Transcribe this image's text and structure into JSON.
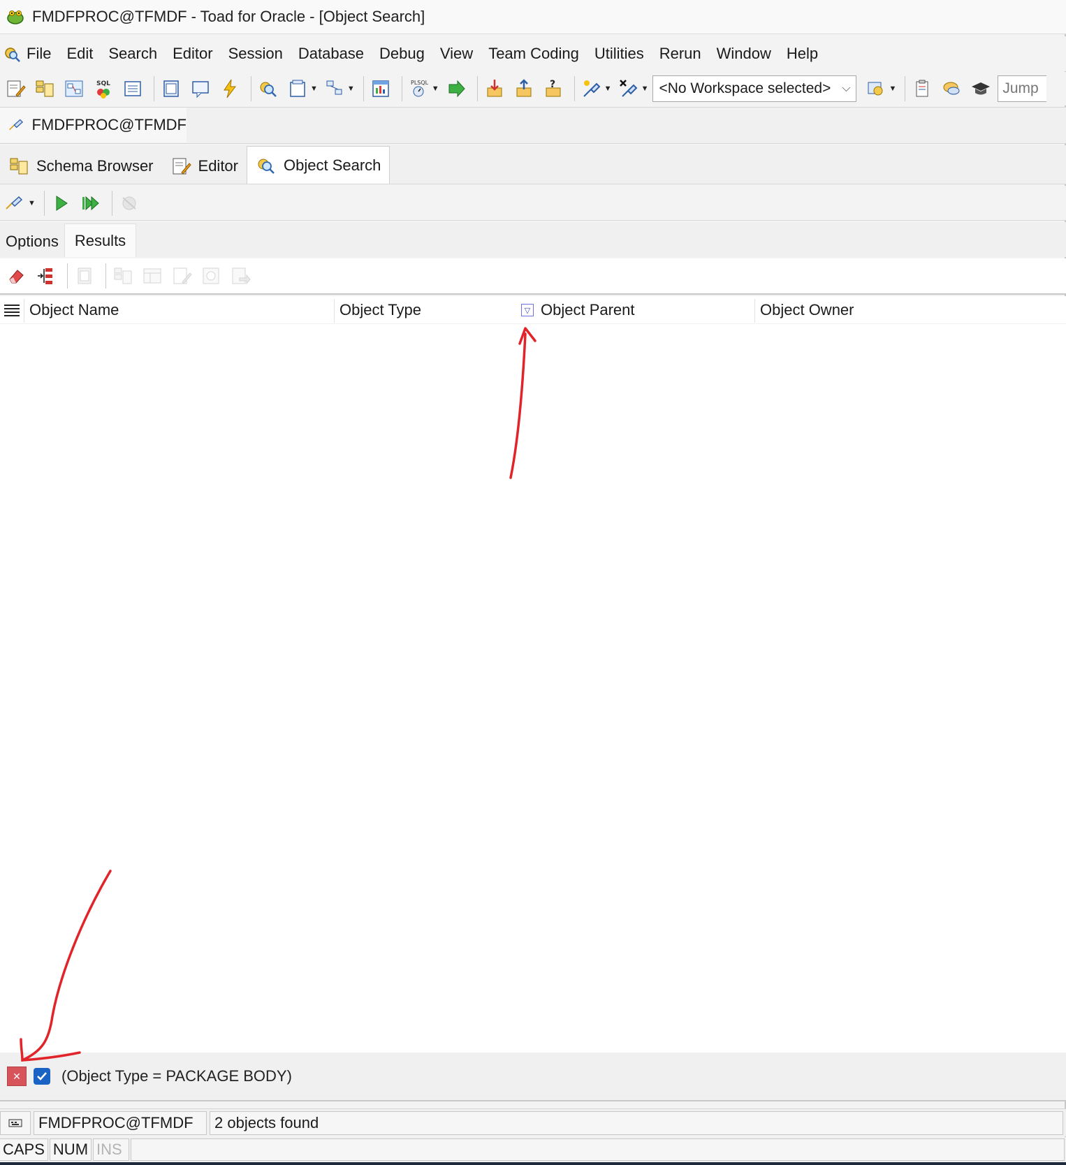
{
  "window": {
    "title": "FMDFPROC@TFMDF - Toad for Oracle - [Object Search]"
  },
  "menu": [
    "File",
    "Edit",
    "Search",
    "Editor",
    "Session",
    "Database",
    "Debug",
    "View",
    "Team Coding",
    "Utilities",
    "Rerun",
    "Window",
    "Help"
  ],
  "toolbar": {
    "workspace_value": "<No Workspace selected>",
    "jump_placeholder": "Jump"
  },
  "connection": {
    "label": "FMDFPROC@TFMDF"
  },
  "window_tabs": [
    {
      "label": "Schema Browser",
      "icon": "schema-browser-icon"
    },
    {
      "label": "Editor",
      "icon": "editor-icon"
    },
    {
      "label": "Object Search",
      "icon": "object-search-icon",
      "active": true
    }
  ],
  "sub_tabs": [
    {
      "label": "Options"
    },
    {
      "label": "Results",
      "active": true
    }
  ],
  "grid": {
    "columns": [
      "Object Name",
      "Object Type",
      "Object Parent",
      "Object Owner"
    ],
    "rows": []
  },
  "filter": {
    "expression": "(Object Type = PACKAGE BODY)",
    "enabled": true
  },
  "status": {
    "connection": "FMDFPROC@TFMDF",
    "result": "2 objects found",
    "caps": "CAPS",
    "num": "NUM",
    "ins": "INS"
  },
  "colors": {
    "annotation": "#e0242a",
    "filter_close": "#d6545a",
    "filter_check": "#1a62c4"
  }
}
